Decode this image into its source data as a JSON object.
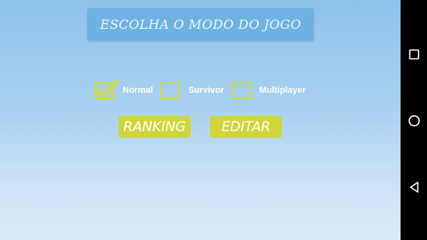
{
  "header": {
    "title": "ESCOLHA O MODO DO JOGO"
  },
  "modes": [
    {
      "label": "Normal",
      "checked": true
    },
    {
      "label": "Survivor",
      "checked": false
    },
    {
      "label": "Multiplayer",
      "checked": false
    }
  ],
  "buttons": {
    "ranking_label": "RANKING",
    "editar_label": "EDITAR"
  },
  "navbar": {
    "icons": [
      "recent-apps-icon",
      "home-icon",
      "back-icon"
    ]
  },
  "colors": {
    "accent": "#d0d63a",
    "title_bg": "#6fb2e2",
    "background_top": "#8ec3ea",
    "background_bottom": "#dbeafa"
  }
}
